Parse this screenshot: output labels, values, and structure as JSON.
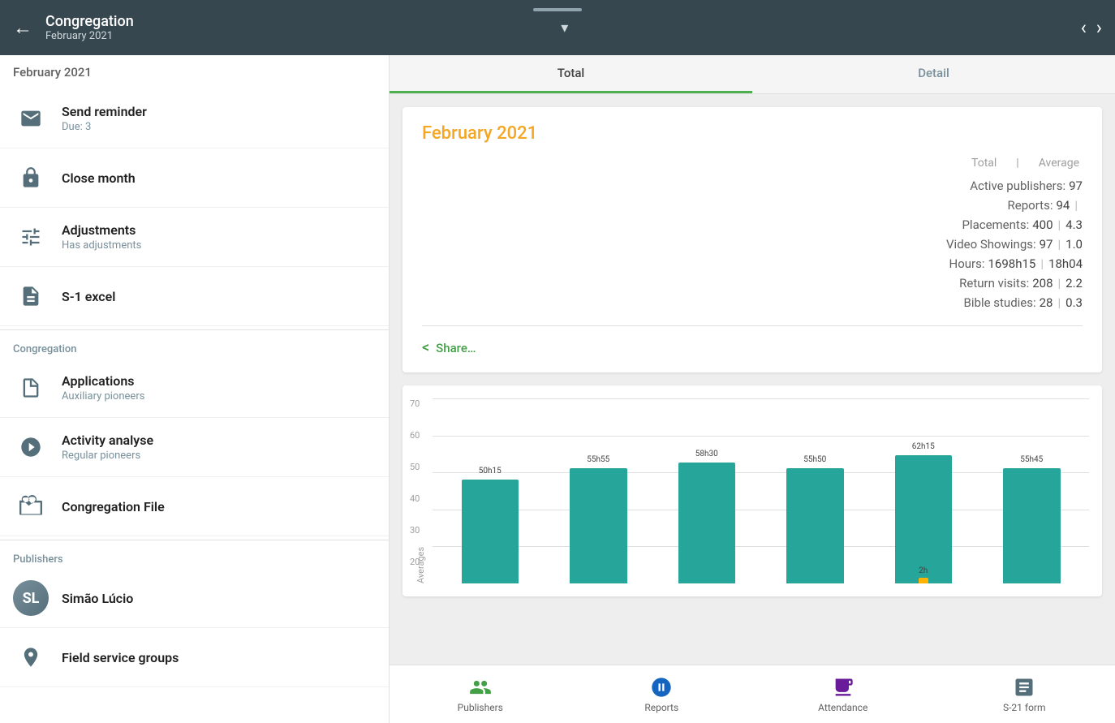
{
  "header": {
    "back_label": "←",
    "title": "Congregation",
    "subtitle": "February 2021",
    "nav_prev": "‹",
    "nav_next": "›"
  },
  "sidebar": {
    "section_date": "February 2021",
    "items_actions": [
      {
        "id": "send-reminder",
        "label": "Send reminder",
        "sublabel": "Due: 3"
      },
      {
        "id": "close-month",
        "label": "Close month",
        "sublabel": ""
      },
      {
        "id": "adjustments",
        "label": "Adjustments",
        "sublabel": "Has adjustments"
      },
      {
        "id": "s1-excel",
        "label": "S-1 excel",
        "sublabel": ""
      }
    ],
    "congregation_section": "Congregation",
    "items_congregation": [
      {
        "id": "applications",
        "label": "Applications",
        "sublabel": "Auxiliary pioneers"
      },
      {
        "id": "activity-analyse",
        "label": "Activity analyse",
        "sublabel": "Regular pioneers"
      },
      {
        "id": "congregation-file",
        "label": "Congregation File",
        "sublabel": ""
      }
    ],
    "publishers_section": "Publishers",
    "publisher_name": "Simão Lúcio",
    "field_service_groups": "Field service groups"
  },
  "tabs": [
    {
      "id": "total",
      "label": "Total",
      "active": true
    },
    {
      "id": "detail",
      "label": "Detail",
      "active": false
    }
  ],
  "stats": {
    "month_title": "February 2021",
    "col_total": "Total",
    "col_separator": "|",
    "col_average": "Average",
    "rows": [
      {
        "label": "Active publishers:",
        "total": "97",
        "avg": ""
      },
      {
        "label": "Reports:",
        "total": "94",
        "avg": ""
      },
      {
        "label": "Placements:",
        "total": "400",
        "sep": "|",
        "avg": "4.3"
      },
      {
        "label": "Video Showings:",
        "total": "97",
        "sep": "|",
        "avg": "1.0"
      },
      {
        "label": "Hours:",
        "total": "1698h15",
        "sep": "|",
        "avg": "18h04"
      },
      {
        "label": "Return visits:",
        "total": "208",
        "sep": "|",
        "avg": "2.2"
      },
      {
        "label": "Bible studies:",
        "total": "28",
        "sep": "|",
        "avg": "0.3"
      }
    ],
    "share_label": "Share…"
  },
  "chart": {
    "y_axis_label": "Averages",
    "y_labels": [
      "70",
      "60",
      "50",
      "40",
      "30",
      "20"
    ],
    "bars": [
      {
        "label": "50h15",
        "height_pct": 71,
        "small_height_pct": 0
      },
      {
        "label": "55h55",
        "height_pct": 79,
        "small_height_pct": 0
      },
      {
        "label": "58h30",
        "height_pct": 83,
        "small_height_pct": 0
      },
      {
        "label": "55h50",
        "height_pct": 79,
        "small_height_pct": 0
      },
      {
        "label": "62h15",
        "height_pct": 88,
        "small_height_pct": 3,
        "small_label": "2h"
      },
      {
        "label": "55h45",
        "height_pct": 79,
        "small_height_pct": 0
      }
    ]
  },
  "bottom_nav": [
    {
      "id": "publishers",
      "label": "Publishers"
    },
    {
      "id": "reports",
      "label": "Reports"
    },
    {
      "id": "attendance",
      "label": "Attendance"
    },
    {
      "id": "s21form",
      "label": "S-21 form"
    }
  ]
}
